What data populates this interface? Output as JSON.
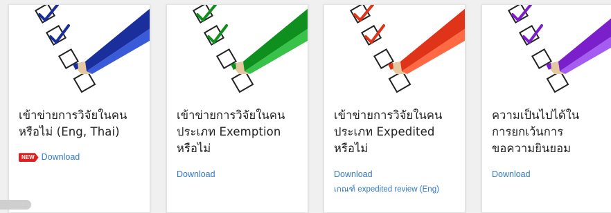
{
  "cards": [
    {
      "title": "เข้าข่ายการวิจัยในคน\nหรือไม่ (Eng, Thai)",
      "badge": "NEW",
      "download_label": "Download",
      "accent": "#1a2f9c",
      "accent_light": "#3a5bd8",
      "icon": "checklist-blue-pencil-icon"
    },
    {
      "title": "เข้าข่ายการวิจัยในคน\nประเภท Exemption\nหรือไม่",
      "download_label": "Download",
      "accent": "#0e8f1e",
      "accent_light": "#38c24a",
      "icon": "checklist-green-pencil-icon"
    },
    {
      "title": "เข้าข่ายการวิจัยในคน\nประเภท Expedited\nหรือไม่",
      "download_label": "Download",
      "extra_label": "เกณฑ์ expedited review (Eng)",
      "accent": "#e0341a",
      "accent_light": "#ff6a44",
      "icon": "checklist-red-pencil-icon"
    },
    {
      "title": "ความเป็นไปได้ใน\nการยกเว้นการ\nขอความยินยอม",
      "download_label": "Download",
      "accent": "#7a1fc9",
      "accent_light": "#a45df0",
      "icon": "checklist-purple-pencil-icon"
    }
  ]
}
